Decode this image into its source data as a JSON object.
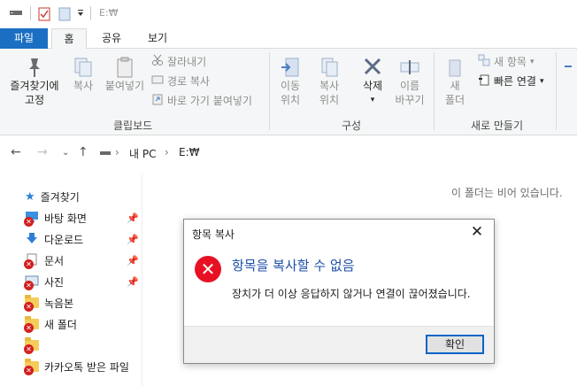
{
  "titlebar": {
    "path": "E:₩"
  },
  "tabs": [
    "파일",
    "홈",
    "공유",
    "보기"
  ],
  "ribbon": {
    "clipboard": {
      "pin_label_1": "즐겨찾기에",
      "pin_label_2": "고정",
      "copy": "복사",
      "paste": "붙여넣기",
      "cut": "잘라내기",
      "copy_path": "경로 복사",
      "paste_shortcut": "바로 가기 붙여넣기",
      "group": "클립보드"
    },
    "organize": {
      "move_1": "이동",
      "move_2": "위치",
      "copyto_1": "복사",
      "copyto_2": "위치",
      "delete": "삭제",
      "rename_1": "이름",
      "rename_2": "바꾸기",
      "group": "구성"
    },
    "new": {
      "new_folder_1": "새",
      "new_folder_2": "폴더",
      "new_item": "새 항목",
      "easy_access": "빠른 연결",
      "group": "새로 만들기"
    }
  },
  "address": {
    "root": "내 PC",
    "current": "E:₩"
  },
  "nav": {
    "quick_access": "즐겨찾기",
    "items": [
      "바탕 화면",
      "다운로드",
      "문서",
      "사진",
      "녹음본",
      "새 폴더",
      "",
      "카카오톡 받은 파일"
    ]
  },
  "content": {
    "empty_message": "이 폴더는 비어 있습니다."
  },
  "dialog": {
    "title": "항목 복사",
    "main": "항목을 복사할 수 없음",
    "detail": "장치가 더 이상 응답하지 않거나 연결이 끊어졌습니다.",
    "ok": "확인"
  },
  "colors": {
    "accent": "#1a6fc2",
    "error": "#e81123",
    "dialog_heading": "#1f4fa8"
  }
}
